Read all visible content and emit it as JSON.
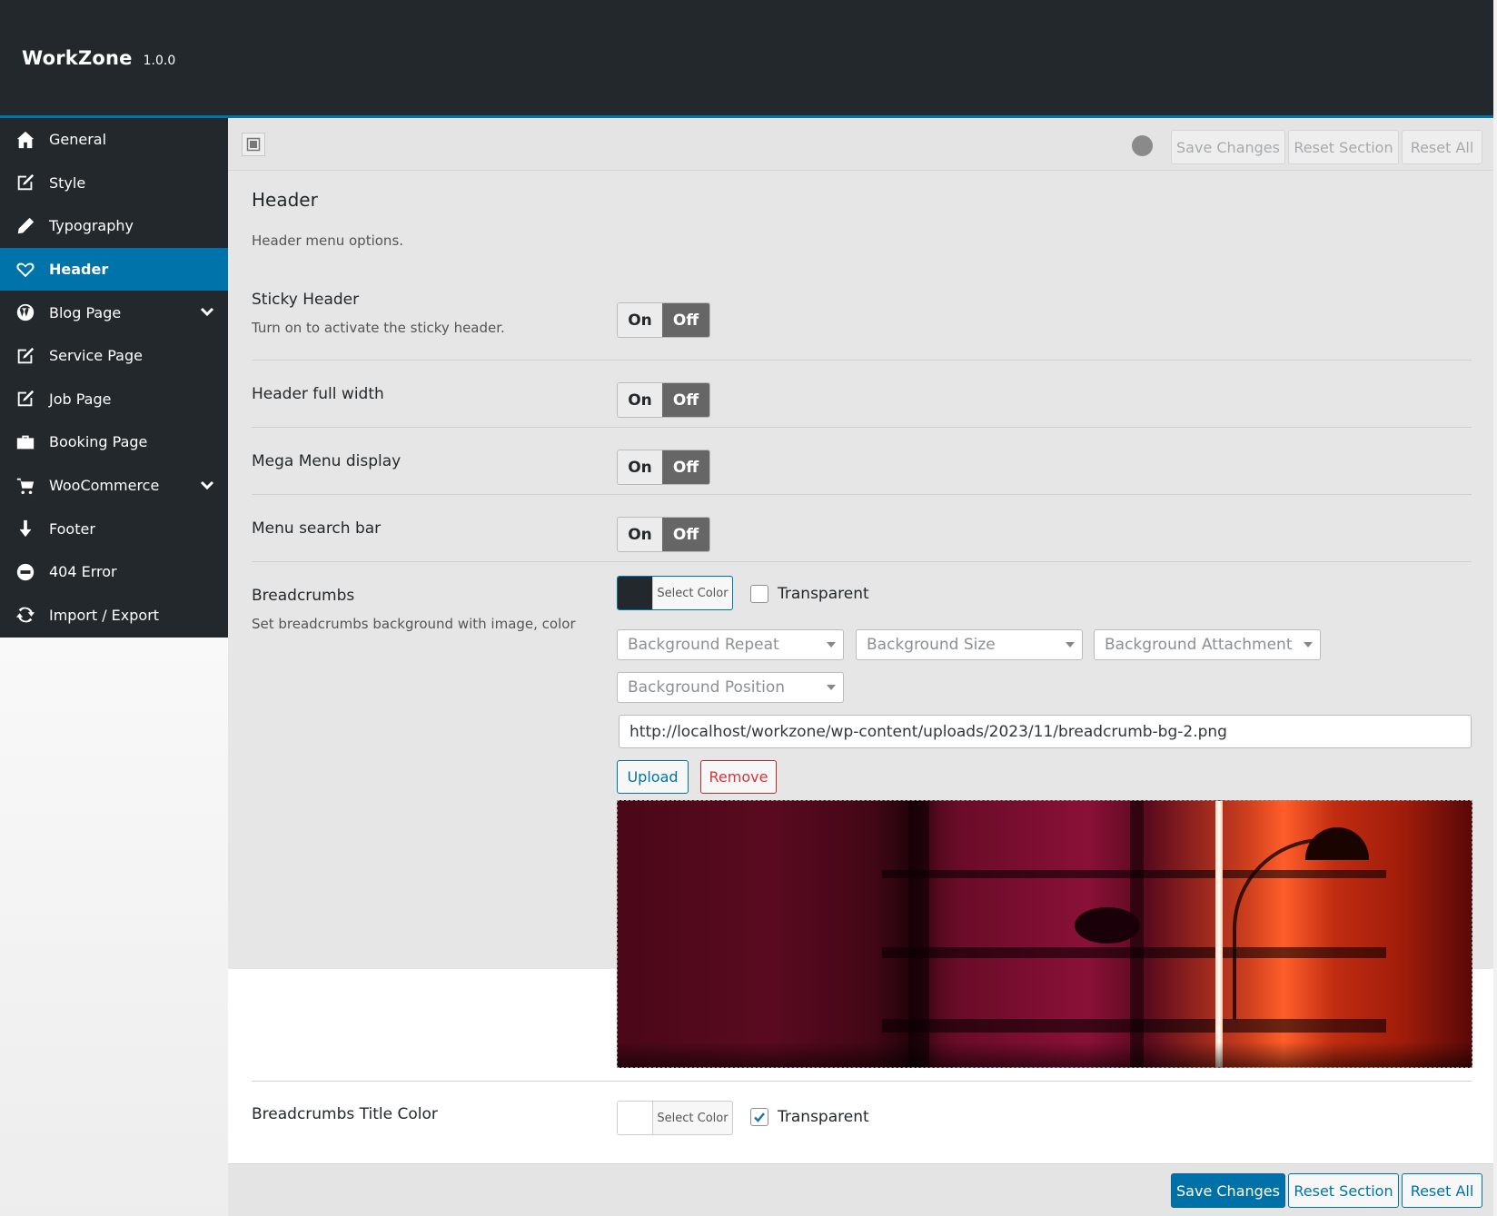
{
  "app": {
    "name": "WorkZone",
    "version": "1.0.0"
  },
  "sidebar": {
    "items": [
      {
        "label": "General",
        "icon": "home-icon"
      },
      {
        "label": "Style",
        "icon": "edit-icon"
      },
      {
        "label": "Typography",
        "icon": "pencil-icon"
      },
      {
        "label": "Header",
        "icon": "heart-icon",
        "active": true
      },
      {
        "label": "Blog Page",
        "icon": "wordpress-icon",
        "submenu": true
      },
      {
        "label": "Service Page",
        "icon": "edit-icon"
      },
      {
        "label": "Job Page",
        "icon": "edit-icon"
      },
      {
        "label": "Booking Page",
        "icon": "briefcase-icon"
      },
      {
        "label": "WooCommerce",
        "icon": "cart-icon",
        "submenu": true
      },
      {
        "label": "Footer",
        "icon": "arrow-down-icon"
      },
      {
        "label": "404 Error",
        "icon": "minus-circle-icon"
      },
      {
        "label": "Import / Export",
        "icon": "refresh-icon"
      }
    ]
  },
  "toolbar": {
    "save_label": "Save Changes",
    "reset_section_label": "Reset Section",
    "reset_all_label": "Reset All"
  },
  "section": {
    "title": "Header",
    "description": "Header menu options."
  },
  "options": {
    "sticky_header": {
      "label": "Sticky Header",
      "description": "Turn on to activate the sticky header.",
      "on_label": "On",
      "off_label": "Off",
      "value": "Off"
    },
    "header_full_width": {
      "label": "Header full width",
      "on_label": "On",
      "off_label": "Off",
      "value": "Off"
    },
    "mega_menu": {
      "label": "Mega Menu display",
      "on_label": "On",
      "off_label": "Off",
      "value": "Off"
    },
    "menu_search": {
      "label": "Menu search bar",
      "on_label": "On",
      "off_label": "Off",
      "value": "Off"
    },
    "breadcrumbs": {
      "label": "Breadcrumbs",
      "description": "Set breadcrumbs background with image, color",
      "color_button": "Select Color",
      "color_value": "#23282d",
      "transparent_label": "Transparent",
      "transparent_checked": false,
      "selects": {
        "repeat": "Background Repeat",
        "size": "Background Size",
        "attachment": "Background Attachment",
        "position": "Background Position"
      },
      "image_url": "http://localhost/workzone/wp-content/uploads/2023/11/breadcrumb-bg-2.png",
      "upload_label": "Upload",
      "remove_label": "Remove"
    },
    "breadcrumbs_title_color": {
      "label": "Breadcrumbs Title Color",
      "color_button": "Select Color",
      "color_value": "#ffffff",
      "transparent_label": "Transparent",
      "transparent_checked": true
    }
  },
  "colors": {
    "accent": "#0073aa",
    "dark": "#23282d",
    "danger": "#d63638"
  }
}
